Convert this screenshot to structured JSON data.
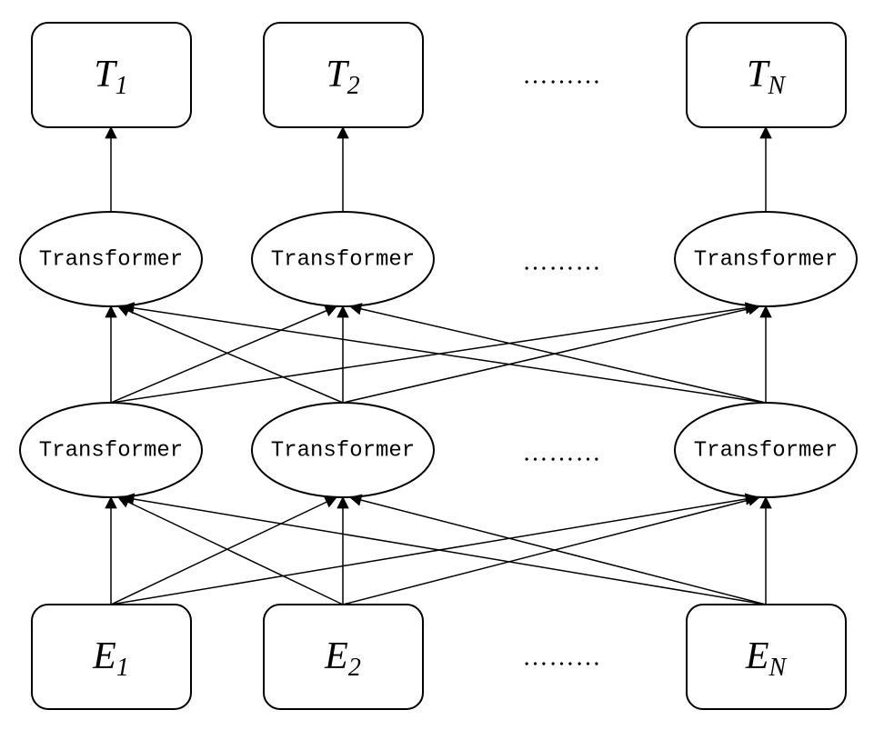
{
  "diagram": {
    "type": "transformer-stack",
    "ellipsis": "………",
    "input_row": {
      "var": "E",
      "nodes": [
        "1",
        "2",
        "N"
      ]
    },
    "output_row": {
      "var": "T",
      "nodes": [
        "1",
        "2",
        "N"
      ]
    },
    "transformer_rows": 2,
    "transformer_label": "Transformer",
    "connections": {
      "input_to_layer1": "all-to-all",
      "layer1_to_layer2": "all-to-all",
      "layer2_to_output": "one-to-one"
    }
  }
}
